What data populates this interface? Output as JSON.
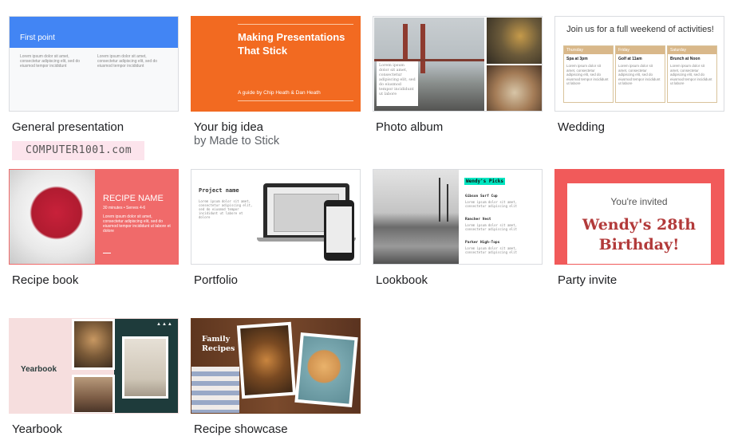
{
  "templates": [
    {
      "label": "General presentation",
      "thumb_title": "First point",
      "sample_text": "Lorem ipsum dolor sit amet, consectetur adipiscing elit, sed do eiusmod tempor incididunt"
    },
    {
      "label": "Your big idea",
      "sublabel": "by Made to Stick",
      "thumb_title": "Making Presentations That Stick",
      "thumb_sub": "A guide by Chip Heath & Dan Heath"
    },
    {
      "label": "Photo album",
      "sample_text": "Lorem ipsum dolor sit amet, consectetur adipiscing elit, sed do eiusmod tempor incididunt ut labore"
    },
    {
      "label": "Wedding",
      "thumb_title": "Join us for a full weekend of activities!",
      "days": [
        {
          "day": "Thursday",
          "event": "Spa at 3pm"
        },
        {
          "day": "Friday",
          "event": "Golf at 11am"
        },
        {
          "day": "Saturday",
          "event": "Brunch at Noon"
        }
      ],
      "sample_text": "Lorem ipsum dolor sit amet, consectetur adipiscing elit, sed do eiusmod tempor incididunt ut labore"
    },
    {
      "label": "Recipe book",
      "thumb_title": "RECIPE NAME",
      "thumb_sub": "30 minutes • Serves 4-6",
      "sample_text": "Lorem ipsum dolor sit amet, consectetur adipiscing elit, sed do eiusmod tempor incididunt ut labore et dolore"
    },
    {
      "label": "Portfolio",
      "thumb_title": "Project name",
      "sample_text": "Lorem ipsum dolor sit amet, consectetur adipiscing elit, sed do eiusmod tempor incididunt ut labore et dolore"
    },
    {
      "label": "Lookbook",
      "thumb_title": "Wendy's Picks",
      "items": [
        "Gibson Surf Cup",
        "Rancher Vest",
        "Parker High-Tops"
      ],
      "sample_text": "Lorem ipsum dolor sit amet, consectetur adipiscing elit"
    },
    {
      "label": "Party invite",
      "thumb_title": "You're invited",
      "thumb_sub": "Wendy's 28th Birthday!"
    },
    {
      "label": "Yearbook",
      "thumb_title": "Yearbook"
    },
    {
      "label": "Recipe showcase",
      "thumb_title": "Family Recipes"
    }
  ],
  "watermark": "COMPUTER1001.com",
  "colors": {
    "blue": "#4285f4",
    "orange": "#f26a21",
    "coral": "#f06a6a",
    "party_red": "#f15a5a",
    "birthday_text": "#b23a3a",
    "teal_dark": "#1e3b3b",
    "wood": "#6d3f23"
  },
  "icon_names": [
    "laptop-icon",
    "phone-icon"
  ]
}
